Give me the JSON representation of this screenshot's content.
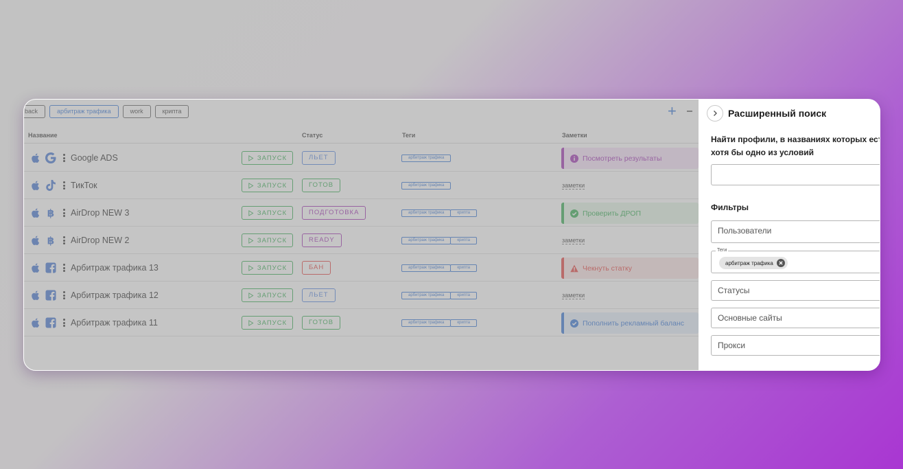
{
  "filter_chips": [
    "back",
    "арбитраж трафика",
    "work",
    "крипта"
  ],
  "toolbar": {
    "add_symbol": "+"
  },
  "table": {
    "headers": {
      "name": "Название",
      "status": "Статус",
      "tags": "Теги",
      "notes": "Заметки"
    },
    "launch_label": "ЗАПУСК",
    "note_placeholder": "заметки",
    "rows": [
      {
        "os": "apple-icon",
        "brand": "google-icon",
        "name": "Google ADS",
        "status": "ЛЬЕТ",
        "status_color": "#4b7fe0",
        "tags": [
          "арбитраж трафика"
        ],
        "note": {
          "text": "Посмотреть результаты",
          "kind": "info",
          "color": "#9c27b0",
          "bg": "#f5e1f8"
        }
      },
      {
        "os": "apple-icon",
        "brand": "tiktok-icon",
        "name": "ТикТок",
        "status": "ГОТОВ",
        "status_color": "#2aa84a",
        "tags": [
          "арбитраж трафика"
        ],
        "note": null
      },
      {
        "os": "apple-icon",
        "brand": "bitcoin-icon",
        "name": "AirDrop NEW 3",
        "status": "ПОДГОТОВКА",
        "status_color": "#9c27b0",
        "tags": [
          "арбитраж трафика",
          "крипта"
        ],
        "note": {
          "text": "Проверить ДРОП",
          "kind": "success",
          "color": "#2aa84a",
          "bg": "#e2f3e4"
        }
      },
      {
        "os": "apple-icon",
        "brand": "bitcoin-icon",
        "name": "AirDrop NEW 2",
        "status": "READY",
        "status_color": "#9c27b0",
        "tags": [
          "арбитраж трафика",
          "крипта"
        ],
        "note": null
      },
      {
        "os": "apple-icon",
        "brand": "facebook-icon",
        "name": "Арбитраж трафика 13",
        "status": "БАН",
        "status_color": "#e53935",
        "tags": [
          "арбитраж трафика",
          "крипта"
        ],
        "note": {
          "text": "Чекнуть статку",
          "kind": "warning",
          "color": "#e53935",
          "bg": "#fbe3e3"
        }
      },
      {
        "os": "apple-icon",
        "brand": "facebook-icon",
        "name": "Арбитраж трафика 12",
        "status": "ЛЬЕТ",
        "status_color": "#4b7fe0",
        "tags": [
          "арбитраж трафика",
          "крипта"
        ],
        "note": null
      },
      {
        "os": "apple-icon",
        "brand": "facebook-icon",
        "name": "Арбитраж трафика 11",
        "status": "ГОТОВ",
        "status_color": "#2aa84a",
        "tags": [
          "арбитраж трафика",
          "крипта"
        ],
        "note": {
          "text": "Пополнить рекламный баланс",
          "kind": "check",
          "color": "#2b6fd6",
          "bg": "#e2edfb"
        }
      }
    ]
  },
  "panel": {
    "title": "Расширенный поиск",
    "description": "Найти профили, в названиях которых есть хотя бы одно из условий",
    "search_value": "",
    "filters_title": "Фильтры",
    "users_placeholder": "Пользователи",
    "tags_legend": "Теги",
    "selected_tag": "арбитраж трафика",
    "statuses_placeholder": "Статусы",
    "sites_placeholder": "Основные сайты",
    "proxy_placeholder": "Прокси"
  }
}
